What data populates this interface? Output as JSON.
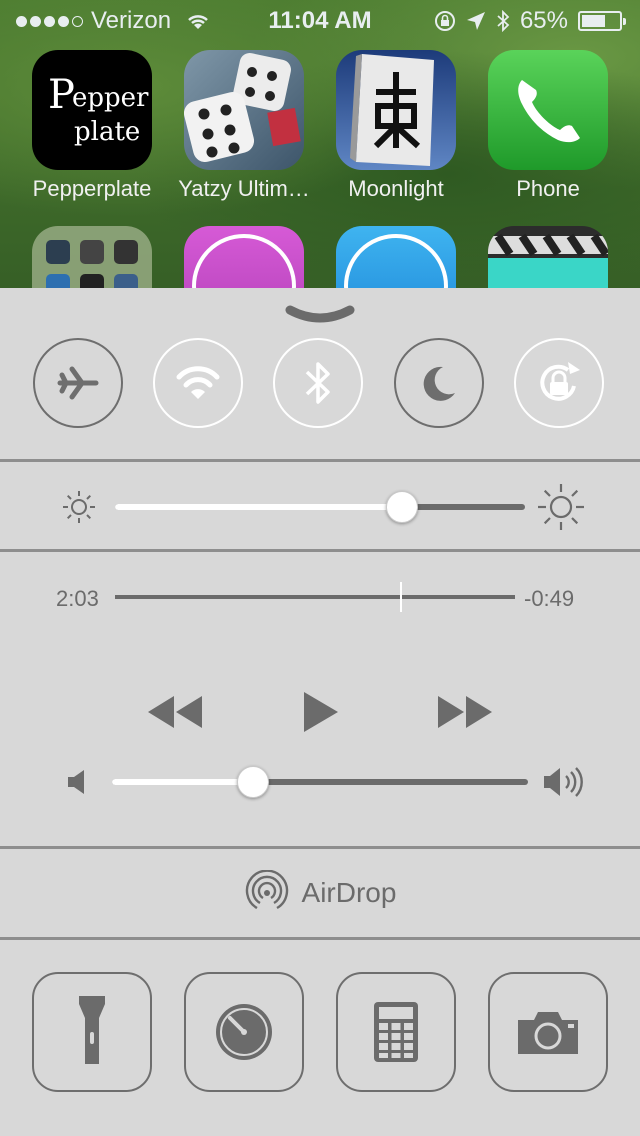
{
  "status": {
    "carrier": "Verizon",
    "signal_dots_filled": 4,
    "signal_dots_total": 5,
    "time": "11:04 AM",
    "battery_percent": "65%",
    "battery_level": 0.65
  },
  "home_apps": [
    {
      "name": "Pepperplate",
      "icon": "pepperplate-app-icon"
    },
    {
      "name": "Yatzy Ultim…",
      "icon": "yatzy-dice-app-icon"
    },
    {
      "name": "Moonlight",
      "icon": "mahjong-tile-app-icon"
    },
    {
      "name": "Phone",
      "icon": "phone-app-icon"
    }
  ],
  "pepperplate_logo_text": "Pepper plate",
  "control_center": {
    "toggles": [
      {
        "name": "airplane-mode",
        "icon": "airplane-icon",
        "state": "off"
      },
      {
        "name": "wifi",
        "icon": "wifi-icon",
        "state": "on"
      },
      {
        "name": "bluetooth",
        "icon": "bluetooth-icon",
        "state": "on"
      },
      {
        "name": "do-not-disturb",
        "icon": "moon-icon",
        "state": "off"
      },
      {
        "name": "rotation-lock",
        "icon": "rotation-lock-icon",
        "state": "on"
      }
    ],
    "brightness_level": 0.7,
    "playback": {
      "elapsed": "2:03",
      "remaining": "-0:49",
      "progress": 0.715
    },
    "volume_level": 0.34,
    "airdrop_label": "AirDrop",
    "shortcuts": [
      {
        "name": "flashlight",
        "icon": "flashlight-icon"
      },
      {
        "name": "timer",
        "icon": "timer-icon"
      },
      {
        "name": "calculator",
        "icon": "calculator-icon"
      },
      {
        "name": "camera",
        "icon": "camera-icon"
      }
    ]
  },
  "colors": {
    "panel": "#d8d8d8",
    "icon_off": "#6e6e6e",
    "icon_on": "#ffffff"
  }
}
